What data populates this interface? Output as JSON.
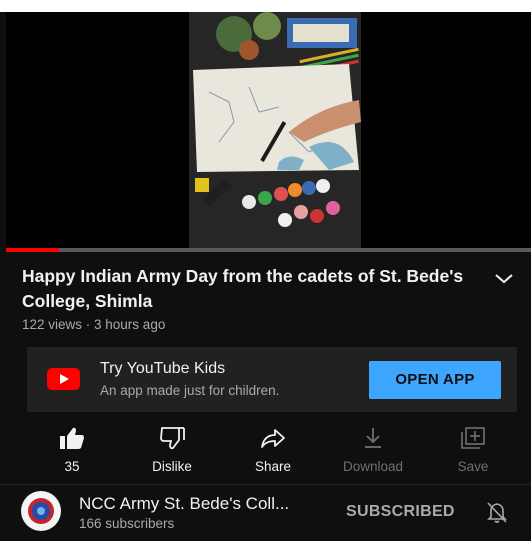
{
  "video": {
    "title": "Happy Indian Army Day from the cadets of St. Bede's College, Shimla",
    "meta": "122 views · 3 hours ago",
    "progress_fraction": 0.1
  },
  "promo": {
    "title": "Try YouTube Kids",
    "subtitle": "An app made just for children.",
    "button": "OPEN APP"
  },
  "actions": [
    {
      "icon": "thumbs-up-icon",
      "label": "35",
      "enabled": true
    },
    {
      "icon": "thumbs-down-icon",
      "label": "Dislike",
      "enabled": true
    },
    {
      "icon": "share-icon",
      "label": "Share",
      "enabled": true
    },
    {
      "icon": "download-icon",
      "label": "Download",
      "enabled": false
    },
    {
      "icon": "save-icon",
      "label": "Save",
      "enabled": false
    }
  ],
  "channel": {
    "name": "NCC Army St. Bede's Coll...",
    "subscribers": "166 subscribers",
    "subscribe_state": "SUBSCRIBED"
  },
  "colors": {
    "background": "#0f0f0f",
    "accent_button": "#3ea6ff",
    "progress": "#ff0000"
  }
}
